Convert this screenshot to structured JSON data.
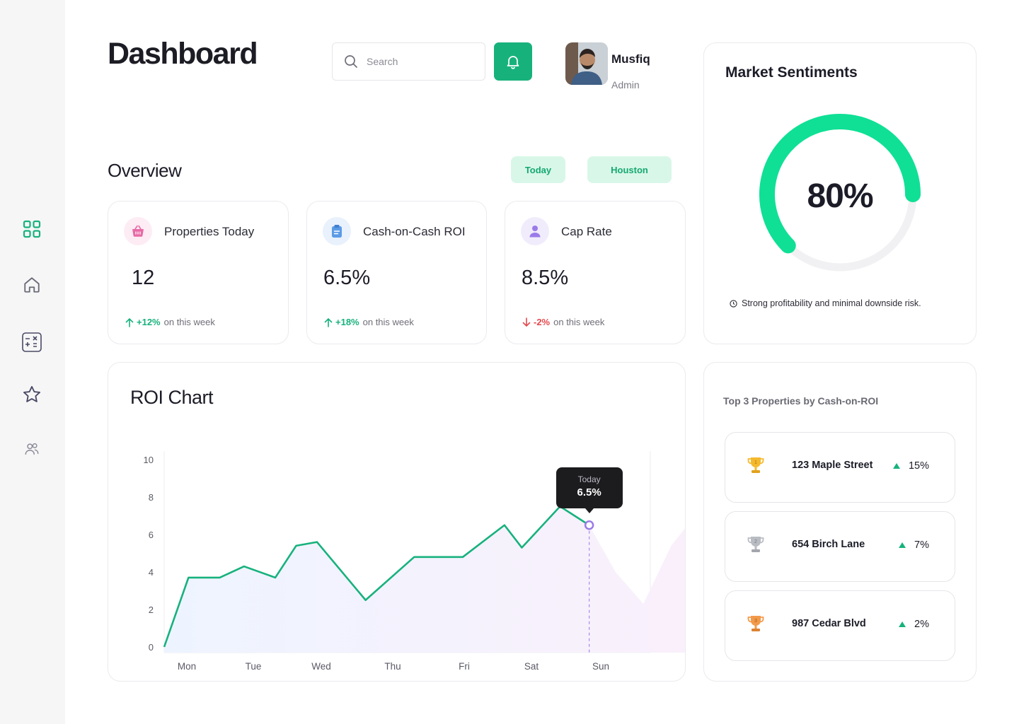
{
  "header": {
    "title": "Dashboard",
    "search_placeholder": "Search",
    "user": {
      "name": "Musfiq",
      "role": "Admin"
    }
  },
  "sidebar": {
    "items": [
      {
        "icon": "grid-icon",
        "active": true
      },
      {
        "icon": "home-icon",
        "active": false
      },
      {
        "icon": "calculator-icon",
        "active": false
      },
      {
        "icon": "star-icon",
        "active": false
      },
      {
        "icon": "users-icon",
        "active": false
      }
    ]
  },
  "overview": {
    "title": "Overview",
    "filters": {
      "period": "Today",
      "location": "Houston"
    },
    "stats": [
      {
        "label": "Properties Today",
        "value": "12",
        "change": "+12%",
        "direction": "up",
        "suffix": "on this week",
        "icon": "basket-icon",
        "color": "#e86aa6"
      },
      {
        "label": "Cash-on-Cash ROI",
        "value": "6.5%",
        "change": "+18%",
        "direction": "up",
        "suffix": "on this week",
        "icon": "clipboard-icon",
        "color": "#5b9be6"
      },
      {
        "label": "Cap Rate",
        "value": "8.5%",
        "change": "-2%",
        "direction": "down",
        "suffix": "on this week",
        "icon": "person-icon",
        "color": "#9a7be8"
      }
    ]
  },
  "market_sentiments": {
    "title": "Market Sentiments",
    "value": "80%",
    "fraction": 0.8,
    "note": "Strong profitability and minimal downside risk.",
    "accent": "#0fe096"
  },
  "roi_chart": {
    "title": "ROI Chart",
    "tooltip": {
      "label": "Today",
      "value": "6.5%"
    }
  },
  "chart_data": {
    "type": "line",
    "ylim": [
      0,
      10
    ],
    "yticks": [
      "0",
      "2",
      "4",
      "6",
      "8",
      "10"
    ],
    "xticks": [
      "Mon",
      "Tue",
      "Wed",
      "Thu",
      "Fri",
      "Sat",
      "Sun"
    ],
    "series": [
      {
        "x": [
          0,
          0.35,
          0.8,
          1.15,
          1.6,
          1.9,
          2.2,
          2.9,
          3.6,
          4.3,
          4.9,
          5.15,
          5.7,
          6.12,
          6.72,
          7.0
        ],
        "y": [
          0,
          3.7,
          3.7,
          4.3,
          3.7,
          5.4,
          5.6,
          2.5,
          4.8,
          4.8,
          6.5,
          5.3,
          7.5,
          6.5,
          null,
          null
        ]
      }
    ],
    "forecast": {
      "x": [
        6.12,
        6.5,
        6.9,
        7.3,
        7.6,
        7.9
      ],
      "y": [
        6.5,
        4.0,
        2.3,
        5.4,
        6.8,
        7.7
      ]
    },
    "highlight_index": 13
  },
  "top_properties": {
    "title": "Top 3 Properties by Cash-on-ROI",
    "items": [
      {
        "rank": "1",
        "name": "123 Maple Street",
        "change": "15%",
        "color": "#f5b92e"
      },
      {
        "rank": "2",
        "name": "654 Birch Lane",
        "change": "7%",
        "color": "#b9bcc2"
      },
      {
        "rank": "3",
        "name": "987 Cedar Blvd",
        "change": "2%",
        "color": "#f29a4a"
      }
    ]
  }
}
